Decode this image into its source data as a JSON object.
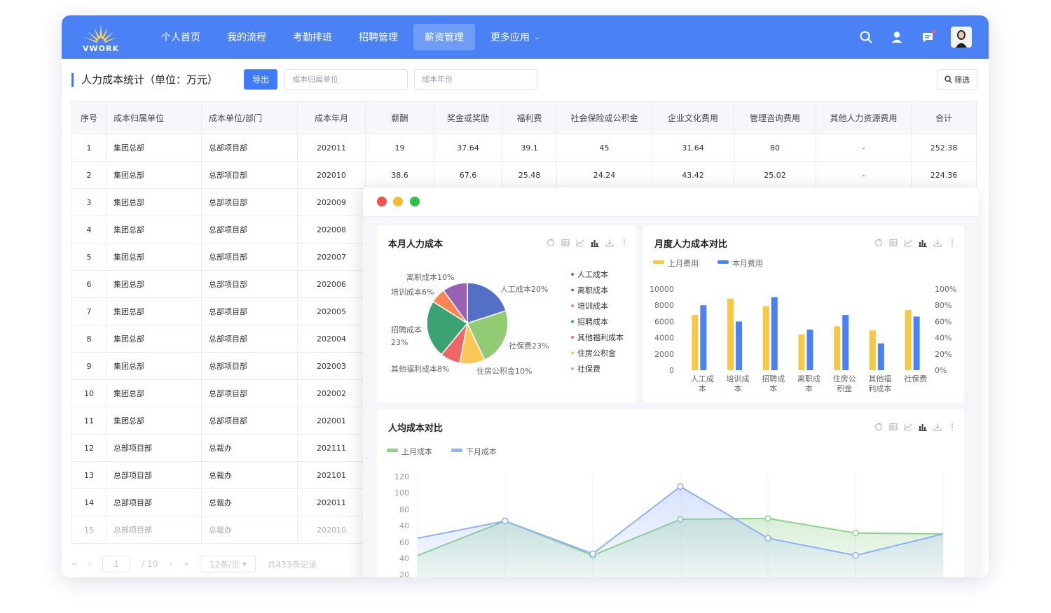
{
  "app": {
    "logo_text": "VWORK"
  },
  "nav": [
    {
      "label": "个人首页",
      "active": false
    },
    {
      "label": "我的流程",
      "active": false
    },
    {
      "label": "考勤排班",
      "active": false
    },
    {
      "label": "招聘管理",
      "active": false
    },
    {
      "label": "薪资管理",
      "active": true
    },
    {
      "label": "更多应用",
      "active": false,
      "dropdown": true
    }
  ],
  "header_icons": [
    "search-icon",
    "user-icon",
    "message-icon",
    "avatar"
  ],
  "colors": {
    "primary": "#4a82f5",
    "yellow": "#f7c845",
    "blue": "#4a82f5",
    "green": "#6cc070"
  },
  "toolbar": {
    "title": "人力成本统计（单位：万元）",
    "export_label": "导出",
    "unit_placeholder": "成本归属单位",
    "month_placeholder": "成本年份",
    "filter_label": "筛选"
  },
  "table": {
    "headers": [
      "序号",
      "成本归属单位",
      "成本单位/部门",
      "成本年月",
      "薪酬",
      "奖金或奖励",
      "福利费",
      "社会保险或公积金",
      "企业文化费用",
      "管理咨询费用",
      "其他人力资源费用",
      "合计"
    ],
    "rows": [
      [
        "1",
        "集团总部",
        "总部项目部",
        "202011",
        "19",
        "37.64",
        "39.1",
        "45",
        "31.64",
        "80",
        "-",
        "252.38"
      ],
      [
        "2",
        "集团总部",
        "总部项目部",
        "202010",
        "38.6",
        "67.6",
        "25.48",
        "24.24",
        "43.42",
        "25.02",
        "-",
        "224.36"
      ],
      [
        "3",
        "集团总部",
        "总部项目部",
        "202009",
        "",
        "",
        "",
        "",
        "",
        "",
        "",
        ""
      ],
      [
        "4",
        "集团总部",
        "总部项目部",
        "202008",
        "",
        "",
        "",
        "",
        "",
        "",
        "",
        ""
      ],
      [
        "5",
        "集团总部",
        "总部项目部",
        "202007",
        "",
        "",
        "",
        "",
        "",
        "",
        "",
        ""
      ],
      [
        "6",
        "集团总部",
        "总部项目部",
        "202006",
        "",
        "",
        "",
        "",
        "",
        "",
        "",
        ""
      ],
      [
        "7",
        "集团总部",
        "总部项目部",
        "202005",
        "",
        "",
        "",
        "",
        "",
        "",
        "",
        ""
      ],
      [
        "8",
        "集团总部",
        "总部项目部",
        "202004",
        "",
        "",
        "",
        "",
        "",
        "",
        "",
        ""
      ],
      [
        "9",
        "集团总部",
        "总部项目部",
        "202003",
        "",
        "",
        "",
        "",
        "",
        "",
        "",
        ""
      ],
      [
        "10",
        "集团总部",
        "总部项目部",
        "202002",
        "",
        "",
        "",
        "",
        "",
        "",
        "",
        ""
      ],
      [
        "11",
        "集团总部",
        "总部项目部",
        "202001",
        "",
        "",
        "",
        "",
        "",
        "",
        "",
        ""
      ],
      [
        "12",
        "总部项目部",
        "总裁办",
        "202111",
        "",
        "",
        "",
        "",
        "",
        "",
        "",
        ""
      ],
      [
        "13",
        "总部项目部",
        "总裁办",
        "202101",
        "",
        "",
        "",
        "",
        "",
        "",
        "",
        ""
      ],
      [
        "14",
        "总部项目部",
        "总裁办",
        "202011",
        "",
        "",
        "",
        "",
        "",
        "",
        "",
        ""
      ],
      [
        "15",
        "总部项目部",
        "总裁办",
        "202010",
        "",
        "",
        "",
        "",
        "",
        "",
        "",
        ""
      ]
    ]
  },
  "pagination": {
    "current": "1",
    "total": "/ 10",
    "page_size": "12条/页",
    "summary": "共433条记录"
  },
  "chart_data": [
    {
      "type": "pie",
      "title": "本月人力成本",
      "slices": [
        {
          "name": "人工成本",
          "value": 20,
          "label": "人工成本20%",
          "color": "#5470c6"
        },
        {
          "name": "社保费",
          "value": 23,
          "label": "社保费23%",
          "color": "#91cc75"
        },
        {
          "name": "住房公积金",
          "value": 10,
          "label": "住房公积金10%",
          "color": "#fac858"
        },
        {
          "name": "其他福利成本",
          "value": 8,
          "label": "其他福利成本8%",
          "color": "#ee6666"
        },
        {
          "name": "招聘成本",
          "value": 23,
          "label_lines": [
            "招聘成本",
            "23%"
          ],
          "color": "#3ba272"
        },
        {
          "name": "培训成本",
          "value": 6,
          "label": "培训成本6%",
          "color": "#fc8452"
        },
        {
          "name": "离职成本",
          "value": 10,
          "label": "离职成本10%",
          "color": "#9a60b4"
        }
      ],
      "legend": [
        {
          "name": "人工成本",
          "color": "#5470c6"
        },
        {
          "name": "离职成本",
          "color": "#9a60b4"
        },
        {
          "name": "培训成本",
          "color": "#fc8452"
        },
        {
          "name": "招聘成本",
          "color": "#3ba272"
        },
        {
          "name": "其他福利成本",
          "color": "#ee6666"
        },
        {
          "name": "住房公积金",
          "color": "#fac858"
        },
        {
          "name": "社保费",
          "color": "#91cc75"
        }
      ]
    },
    {
      "type": "bar",
      "title": "月度人力成本对比",
      "categories": [
        [
          "人工成",
          "本"
        ],
        [
          "培训成",
          "本"
        ],
        [
          "招聘成",
          "本"
        ],
        [
          "离职成",
          "本"
        ],
        [
          "住房公",
          "积金"
        ],
        [
          "其他福",
          "利成本"
        ],
        [
          "社保费"
        ]
      ],
      "series": [
        {
          "name": "上月费用",
          "color": "#f7c845",
          "values": [
            6800,
            8800,
            7900,
            4400,
            5400,
            4900,
            7400
          ]
        },
        {
          "name": "本月费用",
          "color": "#4a82f5",
          "values": [
            8000,
            6000,
            9000,
            5000,
            6800,
            3300,
            6600
          ]
        }
      ],
      "y_left": {
        "ticks": [
          "0",
          "2000",
          "4000",
          "6000",
          "8000",
          "10000"
        ],
        "max": 10000
      },
      "y_right": {
        "ticks": [
          "0%",
          "20%",
          "40%",
          "60%",
          "80%",
          "100%"
        ]
      }
    },
    {
      "type": "area",
      "title": "人均成本对比",
      "x": [
        0,
        1,
        2,
        3,
        4,
        5,
        6
      ],
      "series": [
        {
          "name": "上月成本",
          "color": "#8fd18a",
          "values": [
            40,
            80,
            40,
            82,
            83,
            66,
            65
          ]
        },
        {
          "name": "下月成本",
          "color": "#8fb0f5",
          "values": [
            60,
            80,
            42,
            120,
            60,
            40,
            65
          ]
        }
      ],
      "y_ticks": [
        "20",
        "40",
        "60",
        "80",
        "40",
        "100",
        "120"
      ]
    }
  ]
}
